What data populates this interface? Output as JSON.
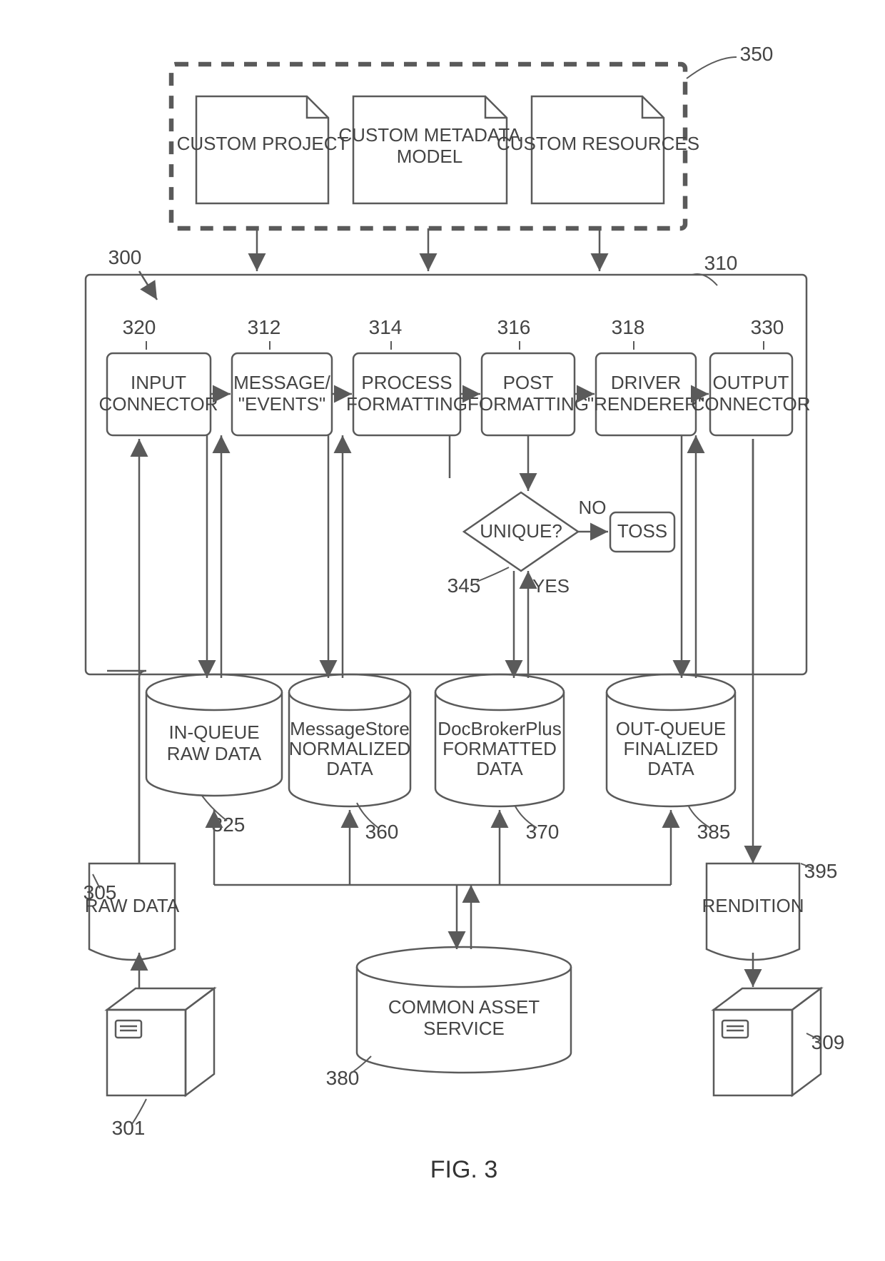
{
  "figureLabel": "FIG. 3",
  "labels": {
    "n300": "300",
    "n350": "350",
    "n310": "310",
    "n320": "320",
    "n312": "312",
    "n314": "314",
    "n316": "316",
    "n318": "318",
    "n330": "330",
    "n345": "345",
    "n325": "325",
    "n360": "360",
    "n370": "370",
    "n385": "385",
    "n380": "380",
    "n305": "305",
    "n301": "301",
    "n395": "395",
    "n309": "309"
  },
  "boxes": {
    "customProject": "CUSTOM PROJECT",
    "customMetadata": [
      "CUSTOM METADATA",
      "MODEL"
    ],
    "customResources": "CUSTOM RESOURCES",
    "inputConnector": [
      "INPUT",
      "CONNECTOR"
    ],
    "messageEvents": [
      "MESSAGE/",
      "\"EVENTS\""
    ],
    "processFmt": [
      "PROCESS",
      "FORMATTING"
    ],
    "postFmt": [
      "POST",
      "FORMATTING"
    ],
    "driver": [
      "DRIVER",
      "\"RENDERER\""
    ],
    "outputConnector": [
      "OUTPUT",
      "CONNECTOR"
    ],
    "unique": "UNIQUE?",
    "yes": "YES",
    "no": "NO",
    "toss": "TOSS"
  },
  "cyls": {
    "inQueue": [
      "IN-QUEUE",
      "RAW DATA"
    ],
    "msgStore": [
      "MessageStore",
      "NORMALIZED",
      "DATA"
    ],
    "docBroker": [
      "DocBrokerPlus",
      "FORMATTED",
      "DATA"
    ],
    "outQueue": [
      "OUT-QUEUE",
      "FINALIZED",
      "DATA"
    ],
    "cas": [
      "COMMON ASSET",
      "SERVICE"
    ]
  },
  "docs": {
    "rawData": "RAW DATA",
    "rendition": "RENDITION"
  }
}
